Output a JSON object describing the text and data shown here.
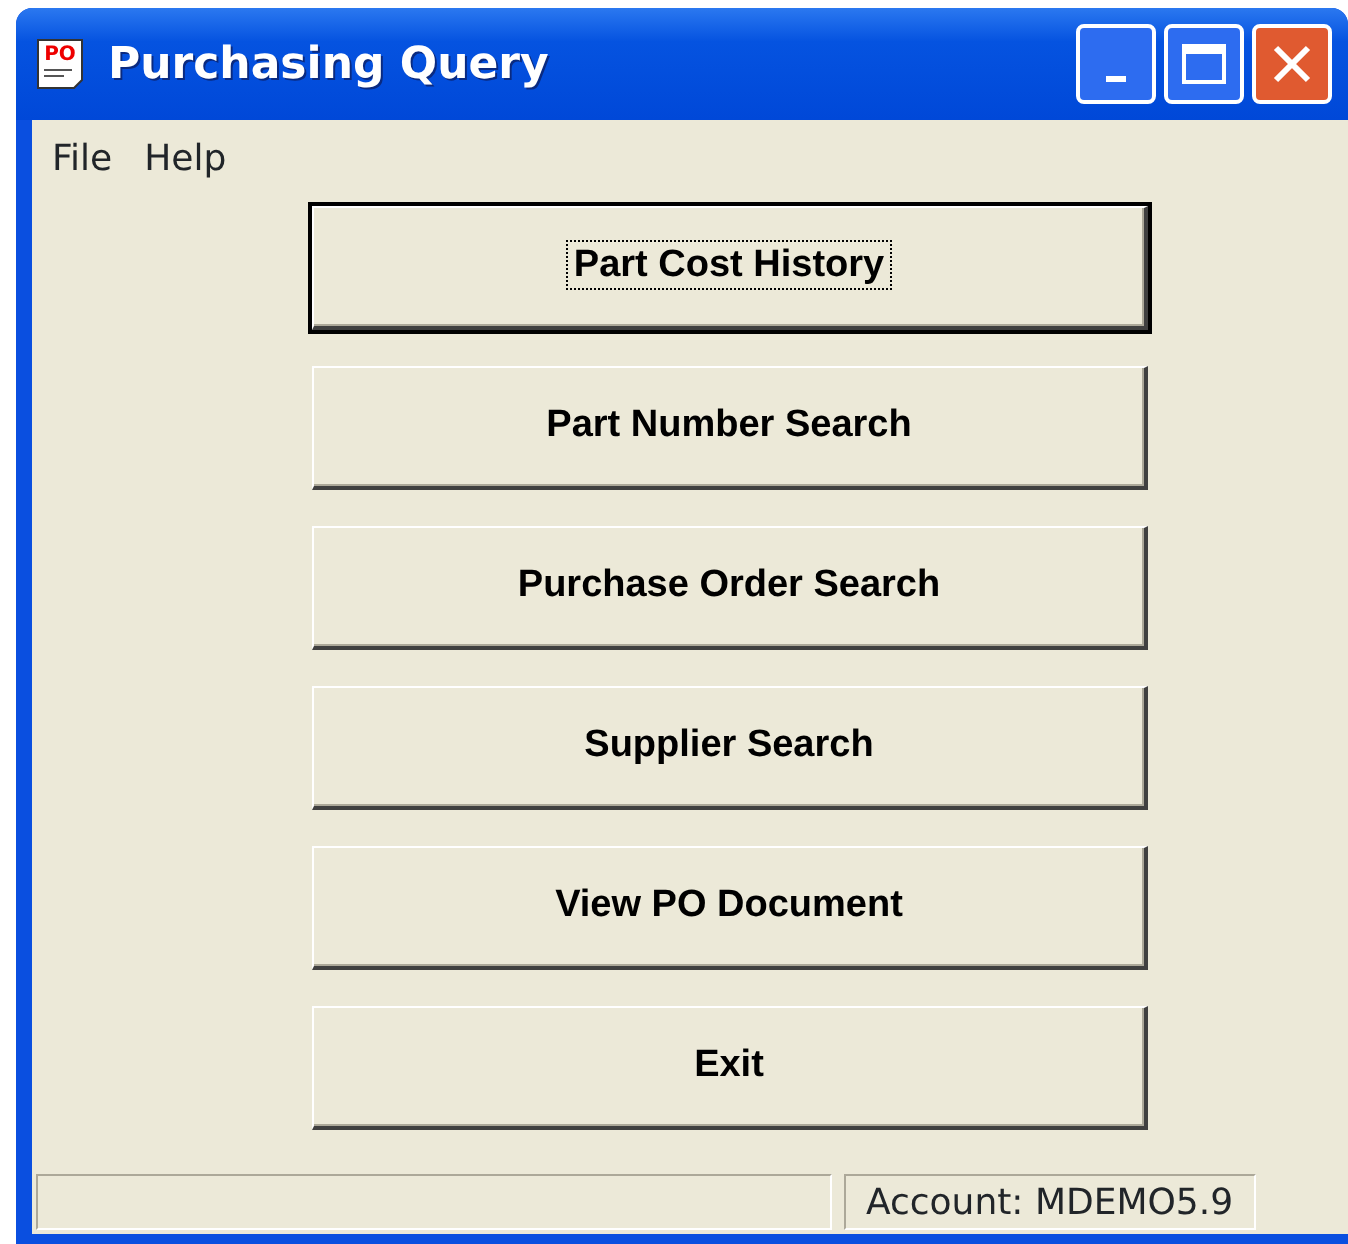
{
  "window": {
    "title": "Purchasing Query",
    "icon_text": "PO"
  },
  "menu": [
    "File",
    "Help"
  ],
  "buttons": [
    {
      "label": "Part Cost History",
      "focused": true
    },
    {
      "label": "Part Number Search",
      "focused": false
    },
    {
      "label": "Purchase Order Search",
      "focused": false
    },
    {
      "label": "Supplier Search",
      "focused": false
    },
    {
      "label": "View PO Document",
      "focused": false
    },
    {
      "label": "Exit",
      "focused": false
    }
  ],
  "status_bar": {
    "account": "Account: MDEMO5.9"
  }
}
